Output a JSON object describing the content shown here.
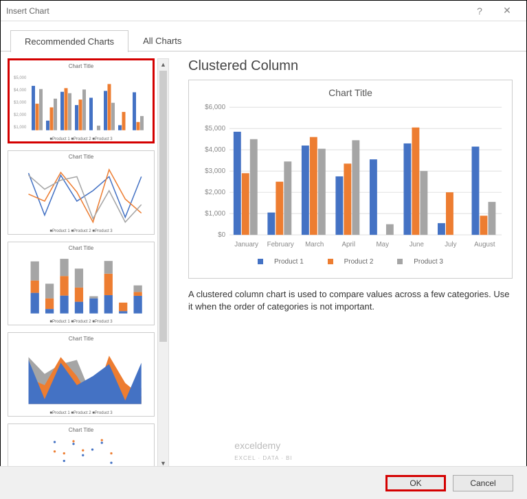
{
  "window": {
    "title": "Insert Chart",
    "help": "?",
    "close": "✕"
  },
  "tabs": {
    "recommended": "Recommended Charts",
    "all": "All Charts"
  },
  "thumb_title": "Chart Title",
  "thumb_legend": "■Product 1  ■Product 2  ■Product 3",
  "scroll": {
    "up": "▲",
    "down": "▼"
  },
  "main": {
    "heading": "Clustered Column",
    "chart_title": "Chart Title",
    "description": "A clustered column chart is used to compare values across a few categories. Use it when the order of categories is not important."
  },
  "legend": {
    "p1": "Product 1",
    "p2": "Product 2",
    "p3": "Product 3"
  },
  "colors": {
    "p1": "#4472C4",
    "p2": "#ED7D31",
    "p3": "#A5A5A5"
  },
  "chart_data": {
    "type": "bar",
    "title": "Chart Title",
    "xlabel": "",
    "ylabel": "",
    "ylim": [
      0,
      6000
    ],
    "yticks": [
      "$6,000",
      "$5,000",
      "$4,000",
      "$3,000",
      "$2,000",
      "$1,000",
      "$0"
    ],
    "categories": [
      "January",
      "February",
      "March",
      "April",
      "May",
      "June",
      "July",
      "August"
    ],
    "series": [
      {
        "name": "Product 1",
        "color": "#4472C4",
        "values": [
          4850,
          1050,
          4200,
          2750,
          3550,
          4300,
          550,
          4150
        ]
      },
      {
        "name": "Product 2",
        "color": "#ED7D31",
        "values": [
          2900,
          2500,
          4600,
          3350,
          0,
          5050,
          2000,
          900
        ]
      },
      {
        "name": "Product 3",
        "color": "#A5A5A5",
        "values": [
          4500,
          3450,
          4050,
          4450,
          500,
          3000,
          0,
          1550
        ]
      }
    ]
  },
  "buttons": {
    "ok": "OK",
    "cancel": "Cancel"
  },
  "watermark": {
    "name": "exceldemy",
    "tag": "EXCEL · DATA · BI"
  }
}
